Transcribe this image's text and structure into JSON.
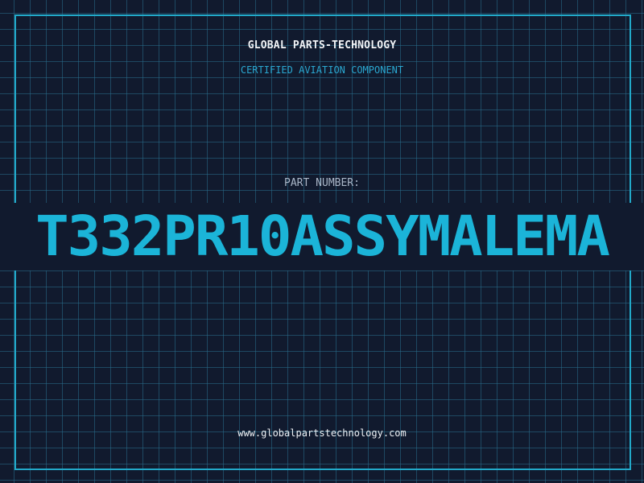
{
  "header": {
    "company": "GLOBAL PARTS-TECHNOLOGY",
    "subtitle": "CERTIFIED AVIATION COMPONENT"
  },
  "part": {
    "label": "PART NUMBER:",
    "number": "T332PR10ASSYMALEMA"
  },
  "footer": {
    "website": "www.globalpartstechnology.com"
  },
  "colors": {
    "background": "#111a2e",
    "grid": "#286e8c",
    "accent": "#1bb4d8",
    "title_text": "#f2f4f7",
    "label_text": "#a9b6c8"
  }
}
